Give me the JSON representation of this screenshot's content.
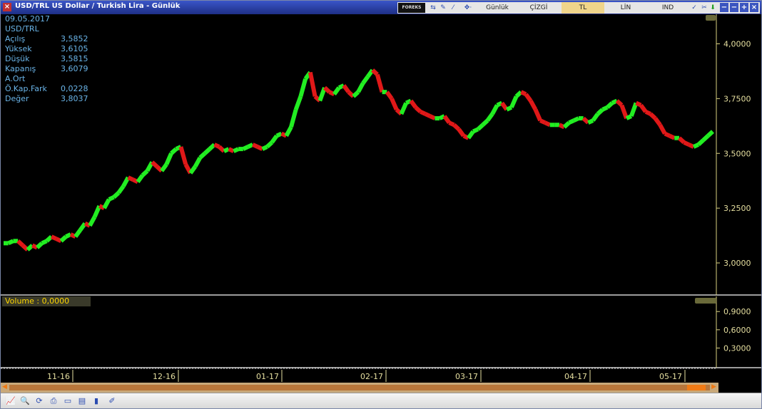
{
  "window": {
    "title": "USD/TRL US Dollar / Turkish Lira - Günlük"
  },
  "toolbar": {
    "forex_logo": "FOREKS",
    "period": "Günlük",
    "chart_style": "ÇİZGİ",
    "currency": "TL",
    "scale": "LİN",
    "indicator": "IND"
  },
  "info_panel": {
    "date": "09.05.2017",
    "symbol": "USD/TRL",
    "rows": [
      {
        "label": "Açılış",
        "value": "3,5852"
      },
      {
        "label": "Yüksek",
        "value": "3,6105"
      },
      {
        "label": "Düşük",
        "value": "3,5815"
      },
      {
        "label": "Kapanış",
        "value": "3,6079"
      },
      {
        "label": "A.Ort",
        "value": ""
      },
      {
        "label": "Ö.Kap.Fark",
        "value": "0,0228"
      },
      {
        "label": "Değer",
        "value": "3,8037"
      }
    ]
  },
  "volume_panel": {
    "label": "Volume : 0,0000"
  },
  "colors": {
    "up": "#22ee22",
    "down": "#e01818",
    "axis": "#d8d080",
    "grid": "#d8d080"
  },
  "chart_data": {
    "type": "line",
    "price_axis": {
      "ticks": [
        "4,0000",
        "3,7500",
        "3,5000",
        "3,2500",
        "3,0000"
      ],
      "tick_values": [
        4.0,
        3.75,
        3.5,
        3.25,
        3.0
      ]
    },
    "volume_axis": {
      "ticks": [
        "0,9000",
        "0,6000",
        "0,3000"
      ],
      "tick_values": [
        0.9,
        0.6,
        0.3
      ]
    },
    "x_ticks": [
      "11-16",
      "12-16",
      "01-17",
      "02-17",
      "03-17",
      "04-17",
      "05-17"
    ],
    "series": [
      {
        "values": [
          3.09,
          3.09,
          3.1,
          3.1,
          3.08,
          3.06,
          3.08,
          3.07,
          3.09,
          3.1,
          3.12,
          3.11,
          3.1,
          3.12,
          3.13,
          3.12,
          3.15,
          3.18,
          3.17,
          3.21,
          3.26,
          3.25,
          3.29,
          3.3,
          3.32,
          3.35,
          3.39,
          3.38,
          3.37,
          3.4,
          3.42,
          3.46,
          3.44,
          3.42,
          3.45,
          3.5,
          3.52,
          3.53,
          3.45,
          3.41,
          3.44,
          3.48,
          3.5,
          3.52,
          3.54,
          3.53,
          3.51,
          3.52,
          3.51,
          3.52,
          3.52,
          3.53,
          3.54,
          3.53,
          3.52,
          3.53,
          3.55,
          3.58,
          3.59,
          3.58,
          3.62,
          3.7,
          3.76,
          3.84,
          3.87,
          3.76,
          3.74,
          3.8,
          3.78,
          3.77,
          3.8,
          3.81,
          3.78,
          3.76,
          3.78,
          3.82,
          3.85,
          3.88,
          3.86,
          3.78,
          3.78,
          3.75,
          3.7,
          3.68,
          3.73,
          3.74,
          3.71,
          3.69,
          3.68,
          3.67,
          3.66,
          3.66,
          3.67,
          3.64,
          3.63,
          3.61,
          3.58,
          3.57,
          3.6,
          3.61,
          3.63,
          3.65,
          3.68,
          3.72,
          3.73,
          3.7,
          3.71,
          3.76,
          3.78,
          3.77,
          3.74,
          3.7,
          3.65,
          3.64,
          3.63,
          3.63,
          3.63,
          3.62,
          3.64,
          3.65,
          3.66,
          3.66,
          3.64,
          3.65,
          3.68,
          3.7,
          3.71,
          3.73,
          3.74,
          3.72,
          3.66,
          3.67,
          3.73,
          3.72,
          3.69,
          3.68,
          3.66,
          3.63,
          3.59,
          3.58,
          3.57,
          3.57,
          3.55,
          3.54,
          3.53,
          3.54,
          3.56,
          3.58,
          3.6
        ]
      }
    ]
  }
}
